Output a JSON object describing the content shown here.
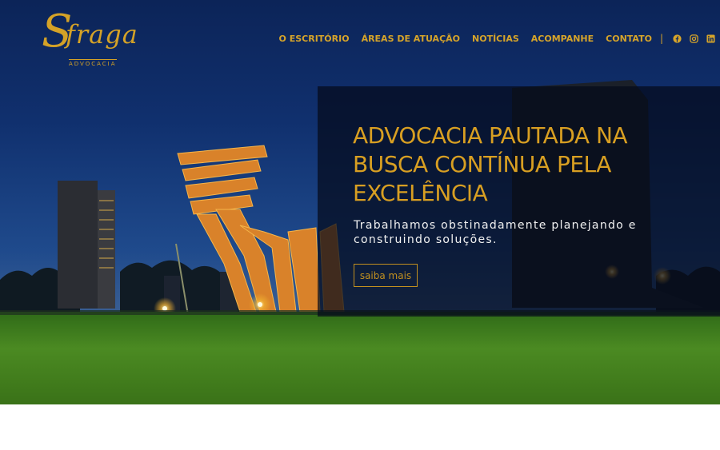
{
  "brand": {
    "logo_initial": "S",
    "logo_word": "fraga",
    "logo_sub": "ADVOCACIA"
  },
  "nav": {
    "items": [
      "O ESCRITÓRIO",
      "ÁREAS DE ATUAÇÃO",
      "NOTÍCIAS",
      "ACOMPANHE",
      "CONTATO"
    ],
    "separator": "|",
    "social_icons": [
      "facebook-icon",
      "instagram-icon",
      "linkedin-icon"
    ]
  },
  "hero": {
    "headline": "ADVOCACIA PAUTADA NA BUSCA CONTÍNUA PELA EXCELÊNCIA",
    "tagline": "Trabalhamos obstinadamente planejando e construindo soluções.",
    "cta_label": "saiba mais"
  },
  "colors": {
    "accent": "#d6a42a",
    "sky": "#10306e",
    "grass": "#3f7a1f",
    "panel": "#040a1a"
  }
}
